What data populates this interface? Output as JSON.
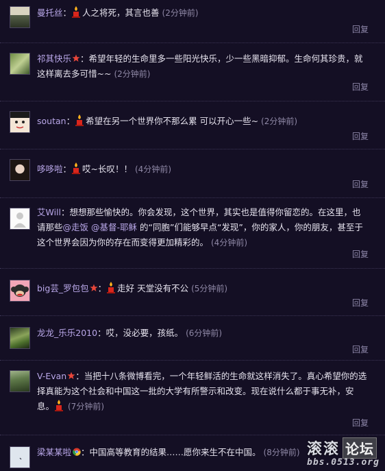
{
  "comments": [
    {
      "user": "曼托丝",
      "text": "人之将死，其言也善",
      "time": "(2分钟前)",
      "reply": "回复"
    },
    {
      "user": "祁其快乐",
      "text": "希望年轻的生命里多一些阳光快乐，少一些黑暗抑郁。生命何其珍贵，就这样离去多可惜~~",
      "time": "(2分钟前)",
      "reply": "回复"
    },
    {
      "user": "soutan",
      "text": "希望在另一个世界你不那么累 可以开心一些~",
      "time": "(2分钟前)",
      "reply": "回复"
    },
    {
      "user": "哆哆啦",
      "text": "哎~长叹！！",
      "time": "(4分钟前)",
      "reply": "回复"
    },
    {
      "user": "艾Will",
      "text_a": "想想那些愉快的。你会发现，这个世界，其实也是值得你留恋的。在这里，也请那些",
      "mention1": "@走饭",
      "mention2": "@基督-耶稣",
      "text_b": " 的“同胞”们能够早点“发现”，你的家人，你的朋友，甚至于这个世界会因为你的存在而变得更加精彩的。",
      "time": "(4分钟前)",
      "reply": "回复"
    },
    {
      "user": "big芸_罗包包",
      "text": "走好 天堂没有不公",
      "time": "(5分钟前)",
      "reply": "回复"
    },
    {
      "user": "龙龙_乐乐2010",
      "text": "哎，没必要，孩纸。",
      "time": "(6分钟前)",
      "reply": "回复"
    },
    {
      "user": "V-Evan",
      "text": "当把十八条微博看完，一个年轻鲜活的生命就这样消失了。真心希望你的选择真能为这个社会和中国这一批的大学有所警示和改变。现在说什么都于事无补，安息。",
      "time": "(7分钟前)",
      "reply": "回复"
    },
    {
      "user": "梁某某啦",
      "text": "中国高等教育的结果……愿你来生不在中国。",
      "time": "(8分钟前)",
      "reply": "回复"
    }
  ],
  "colon": "：",
  "watermark": {
    "a": "滚滚",
    "b": "论坛",
    "url": "bbs.0513.org"
  },
  "icons": {
    "candle": "candle-icon",
    "vip_star": "vip-star-icon",
    "chrome": "chrome-icon"
  }
}
